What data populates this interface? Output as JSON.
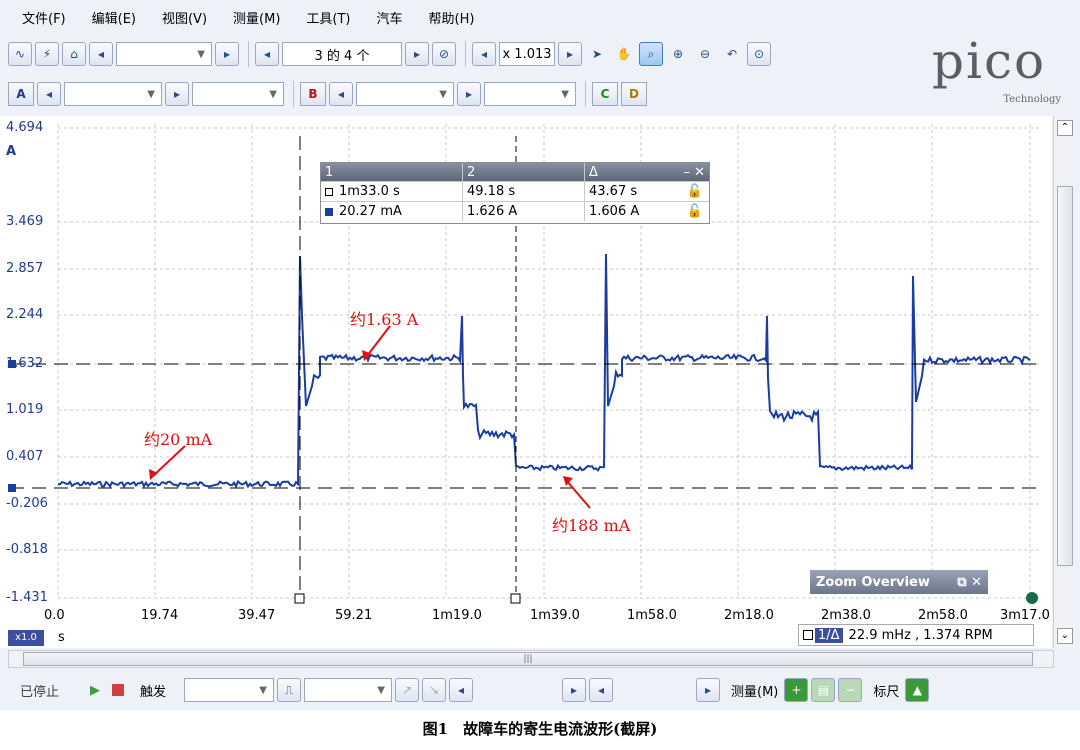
{
  "menu": [
    "文件(F)",
    "编辑(E)",
    "视图(V)",
    "测量(M)",
    "工具(T)",
    "汽车",
    "帮助(H)"
  ],
  "toolbar": {
    "buffer_label": "3 的 4 个",
    "zoom_label": "x 1.013",
    "channel_a": "A",
    "channel_b": "B",
    "channel_c": "C",
    "channel_d": "D"
  },
  "logo": {
    "brand": "pico",
    "sub": "Technology"
  },
  "plot": {
    "unit": "A",
    "time_unit": "s",
    "zoom_badge": "x1.0",
    "yticks": [
      "4.694",
      "3.469",
      "2.857",
      "2.244",
      "1.632",
      "1.019",
      "0.407",
      "-0.206",
      "-0.818",
      "-1.431"
    ],
    "xticks": [
      "0.0",
      "19.74",
      "39.47",
      "59.21",
      "1m19.0",
      "1m39.0",
      "1m58.0",
      "2m18.0",
      "2m38.0",
      "2m58.0",
      "3m17.0"
    ],
    "trace_color": "#1a3da0"
  },
  "rulers": {
    "headers": [
      "1",
      "2",
      "Δ"
    ],
    "rows": [
      [
        "1m33.0 s",
        "49.18 s",
        "43.67 s"
      ],
      [
        "20.27 mA",
        "1.626 A",
        "1.606 A"
      ]
    ]
  },
  "annotations": {
    "a1": "约1.63 A",
    "a2": "约20 mA",
    "a3": "约188 mA"
  },
  "zoom_overview": "Zoom Overview",
  "freq_readout": "22.9 mHz , 1.374 RPM",
  "freq_prefix": "1/Δ",
  "status": {
    "stopped": "已停止",
    "trigger": "触发",
    "measure": "测量(M)",
    "ruler": "标尺"
  },
  "caption": "图1　故障车的寄生电流波形(截屏)"
}
